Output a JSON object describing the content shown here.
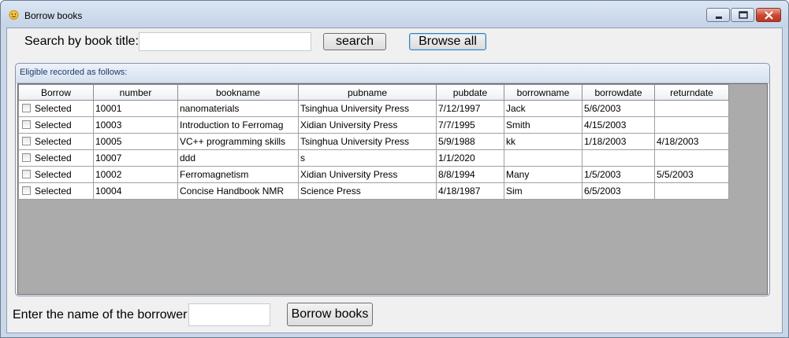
{
  "window": {
    "title": "Borrow books",
    "icon": "app-emoji-icon"
  },
  "search": {
    "label": "Search by book title:",
    "value": "",
    "search_button": "search",
    "browse_button": "Browse all"
  },
  "group": {
    "title": "Eligible recorded as follows:"
  },
  "table": {
    "columns": [
      "Borrow",
      "number",
      "bookname",
      "pubname",
      "pubdate",
      "borrowname",
      "borrowdate",
      "returndate"
    ],
    "rows": [
      {
        "borrow": "Selected",
        "number": "10001",
        "bookname": "nanomaterials",
        "pubname": "Tsinghua University Press",
        "pubdate": "7/12/1997",
        "borrowname": "Jack",
        "borrowdate": "5/6/2003",
        "returndate": ""
      },
      {
        "borrow": "Selected",
        "number": "10003",
        "bookname": "Introduction to Ferromag",
        "pubname": "Xidian University Press",
        "pubdate": "7/7/1995",
        "borrowname": "Smith",
        "borrowdate": "4/15/2003",
        "returndate": ""
      },
      {
        "borrow": "Selected",
        "number": "10005",
        "bookname": "VC++ programming skills",
        "pubname": "Tsinghua University Press",
        "pubdate": "5/9/1988",
        "borrowname": "kk",
        "borrowdate": "1/18/2003",
        "returndate": "4/18/2003"
      },
      {
        "borrow": "Selected",
        "number": "10007",
        "bookname": "ddd",
        "pubname": "s",
        "pubdate": "1/1/2020",
        "borrowname": "",
        "borrowdate": "",
        "returndate": ""
      },
      {
        "borrow": "Selected",
        "number": "10002",
        "bookname": "Ferromagnetism",
        "pubname": "Xidian University Press",
        "pubdate": "8/8/1994",
        "borrowname": "Many",
        "borrowdate": "1/5/2003",
        "returndate": "5/5/2003"
      },
      {
        "borrow": "Selected",
        "number": "10004",
        "bookname": "Concise Handbook NMR",
        "pubname": "Science Press",
        "pubdate": "4/18/1987",
        "borrowname": "Sim",
        "borrowdate": "6/5/2003",
        "returndate": ""
      }
    ]
  },
  "borrower": {
    "label": "Enter the name of the borrower:",
    "value": "",
    "button": "Borrow books"
  }
}
